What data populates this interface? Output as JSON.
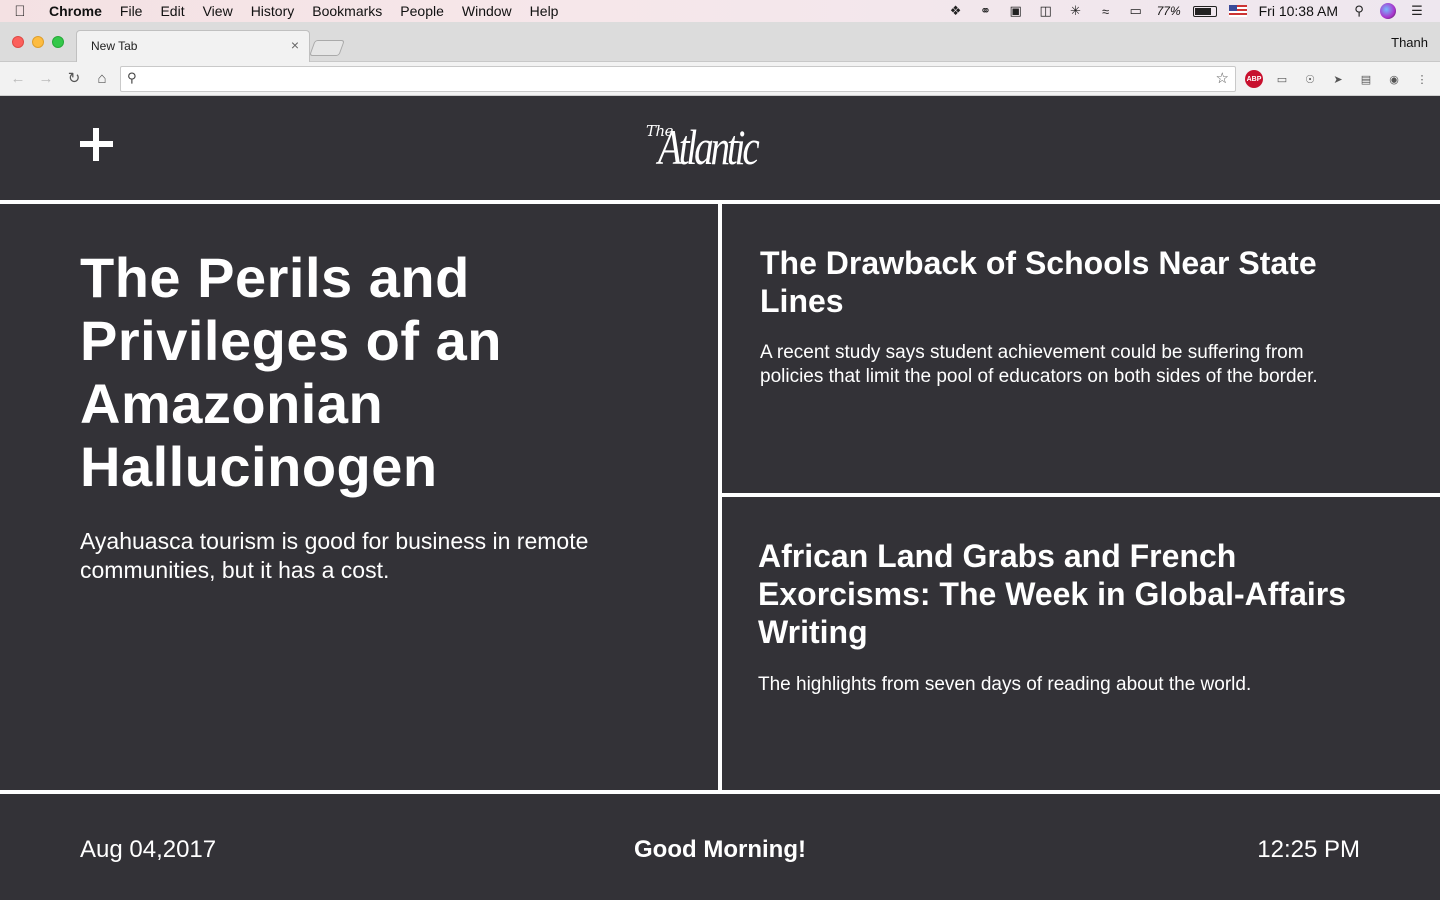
{
  "menubar": {
    "app": "Chrome",
    "items": [
      "File",
      "Edit",
      "View",
      "History",
      "Bookmarks",
      "People",
      "Window",
      "Help"
    ],
    "battery": "77%",
    "clock": "Fri 10:38 AM"
  },
  "browser": {
    "tab_title": "New Tab",
    "tab_close": "×",
    "profile": "Thanh",
    "omnibox_value": ""
  },
  "header": {
    "logo_prefix": "The",
    "logo_main": "Atlantic"
  },
  "feature": {
    "title": "The Perils and Privileges of an Amazonian Hallucinogen",
    "description": "Ayahuasca tourism is good for business in remote communities, but it has a cost."
  },
  "stories": [
    {
      "title": "The Drawback of Schools Near State Lines",
      "description": "A recent study says student achievement could be suffering from policies that limit the pool of educators on both sides of the border."
    },
    {
      "title": "African Land Grabs and French Exorcisms: The Week in Global-Affairs Writing",
      "description": "The highlights from seven days of reading about the world."
    }
  ],
  "footer": {
    "date": "Aug 04,2017",
    "greeting": "Good Morning!",
    "time": "12:25 PM"
  }
}
